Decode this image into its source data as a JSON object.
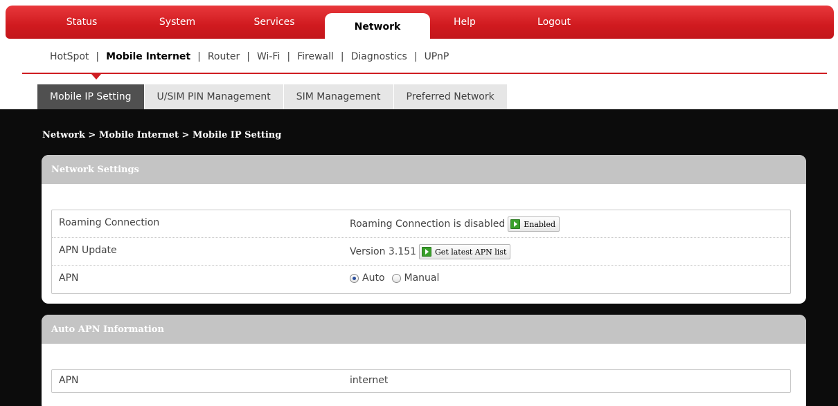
{
  "topnav": {
    "items": [
      {
        "label": "Status"
      },
      {
        "label": "System"
      },
      {
        "label": "Services"
      },
      {
        "label": "Network"
      },
      {
        "label": "Help"
      },
      {
        "label": "Logout"
      }
    ],
    "active": "Network"
  },
  "subnav": {
    "items": [
      {
        "label": "HotSpot"
      },
      {
        "label": "Mobile Internet"
      },
      {
        "label": "Router"
      },
      {
        "label": "Wi-Fi"
      },
      {
        "label": "Firewall"
      },
      {
        "label": "Diagnostics"
      },
      {
        "label": "UPnP"
      }
    ],
    "separator": "|"
  },
  "tabs": [
    {
      "label": "Mobile IP Setting"
    },
    {
      "label": "U/SIM PIN Management"
    },
    {
      "label": "SIM Management"
    },
    {
      "label": "Preferred Network"
    }
  ],
  "breadcrumb": "Network > Mobile Internet > Mobile IP Setting",
  "network_settings": {
    "title": "Network Settings",
    "roaming": {
      "label": "Roaming Connection",
      "status": "Roaming Connection is disabled",
      "button": "Enabled"
    },
    "apn_update": {
      "label": "APN Update",
      "version": "Version 3.151",
      "button": "Get latest APN list"
    },
    "apn": {
      "label": "APN",
      "option_auto": "Auto",
      "option_manual": "Manual",
      "selected": "Auto"
    }
  },
  "auto_apn": {
    "title": "Auto APN Information",
    "apn_label": "APN",
    "apn_value": "internet"
  },
  "colors": {
    "brand_red": "#d01a1f",
    "active_tab": "#505050",
    "panel_header": "#c4c4c4",
    "button_icon_green": "#3aa02b"
  },
  "icons": [
    "play-icon",
    "radio-checked",
    "radio-unchecked",
    "active-arrow-icon"
  ]
}
